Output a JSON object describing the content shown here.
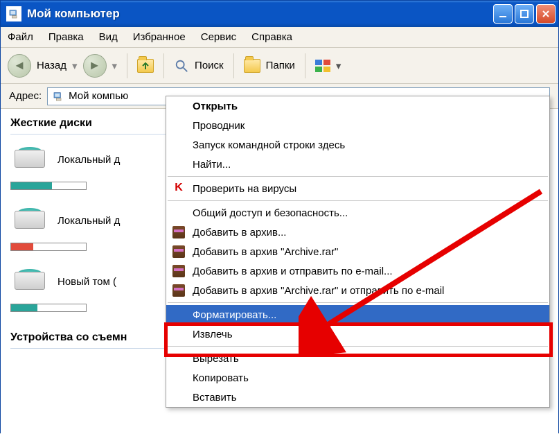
{
  "window": {
    "title": "Мой компьютер"
  },
  "menu": {
    "file": "Файл",
    "edit": "Правка",
    "view": "Вид",
    "favorites": "Избранное",
    "tools": "Сервис",
    "help": "Справка"
  },
  "toolbar": {
    "back": "Назад",
    "search": "Поиск",
    "folders": "Папки"
  },
  "address": {
    "label": "Адрес:",
    "value": "Мой компью"
  },
  "sections": {
    "hdd": "Жесткие диски",
    "removable": "Устройства со съемн"
  },
  "drives": [
    {
      "label": "Локальный д",
      "fill_pct": 55,
      "fill_color": "#2aa59a"
    },
    {
      "label": "Локальный д",
      "fill_pct": 30,
      "fill_color": "#e24b3b"
    },
    {
      "label": "Новый том (",
      "fill_pct": 35,
      "fill_color": "#2aa59a"
    }
  ],
  "context_menu": {
    "items": [
      {
        "label": "Открыть",
        "bold": true
      },
      {
        "label": "Проводник"
      },
      {
        "label": "Запуск командной строки здесь"
      },
      {
        "label": "Найти..."
      },
      {
        "sep": true
      },
      {
        "label": "Проверить на вирусы",
        "icon": "kaspersky"
      },
      {
        "sep": true
      },
      {
        "label": "Общий доступ и безопасность..."
      },
      {
        "label": "Добавить в архив...",
        "icon": "winrar"
      },
      {
        "label": "Добавить в архив \"Archive.rar\"",
        "icon": "winrar"
      },
      {
        "label": "Добавить в архив и отправить по e-mail...",
        "icon": "winrar"
      },
      {
        "label": "Добавить в архив \"Archive.rar\" и отправить по e-mail",
        "icon": "winrar"
      },
      {
        "sep": true
      },
      {
        "label": "Форматировать...",
        "selected": true
      },
      {
        "label": "Извлечь"
      },
      {
        "sep": true
      },
      {
        "label": "Вырезать"
      },
      {
        "label": "Копировать"
      },
      {
        "label": "Вставить"
      }
    ]
  }
}
